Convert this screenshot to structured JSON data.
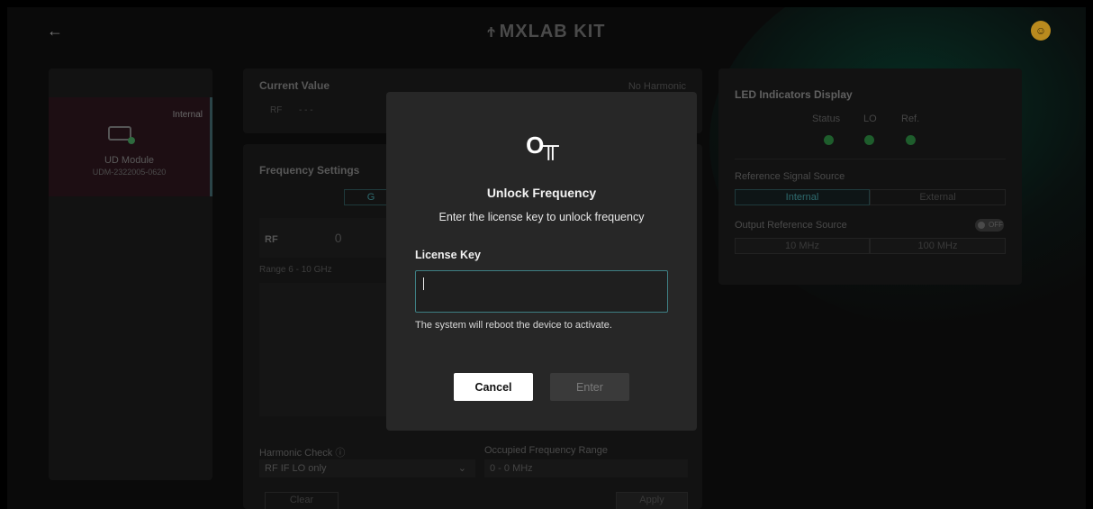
{
  "header": {
    "back_icon": "arrow-left-icon",
    "brand": "MXLAB KIT",
    "brand_mark": "Ϯ",
    "avatar_icon": "user-icon"
  },
  "sidebar": {
    "module": {
      "tag": "Internal",
      "name": "UD Module",
      "serial": "UDM-2322005-0620",
      "icon": "module-device-icon"
    }
  },
  "current_value": {
    "title": "Current Value",
    "harmonic_status": "No Harmonic",
    "rf_label": "RF",
    "rf_value": "- - -"
  },
  "frequency_settings": {
    "title": "Frequency Settings",
    "tab_partial": "G",
    "rf_label": "RF",
    "rf_value": "0",
    "range": "Range 6 - 10 GHz",
    "harmonic_check_label": "Harmonic Check",
    "harmonic_check_value": "RF IF LO only",
    "occupied_label": "Occupied Frequency Range",
    "occupied_value": "0 - 0 MHz",
    "clear_label": "Clear",
    "apply_label": "Apply"
  },
  "led_panel": {
    "title": "LED Indicators Display",
    "leds": [
      "Status",
      "LO",
      "Ref."
    ],
    "led_color": "#1e5d2c",
    "ref_source_label": "Reference Signal Source",
    "ref_options": [
      "Internal",
      "External"
    ],
    "ref_selected": "Internal",
    "output_ref_label": "Output Reference Source",
    "output_toggle": "OFF",
    "output_options": [
      "10 MHz",
      "100 MHz"
    ]
  },
  "modal": {
    "icon": "key-icon",
    "icon_glyph": "O╥",
    "title": "Unlock Frequency",
    "subtitle": "Enter the license key to unlock frequency",
    "field_label": "License Key",
    "field_value": "",
    "note": "The system will reboot the device to activate.",
    "cancel": "Cancel",
    "enter": "Enter",
    "accent": "#3e7f83"
  }
}
